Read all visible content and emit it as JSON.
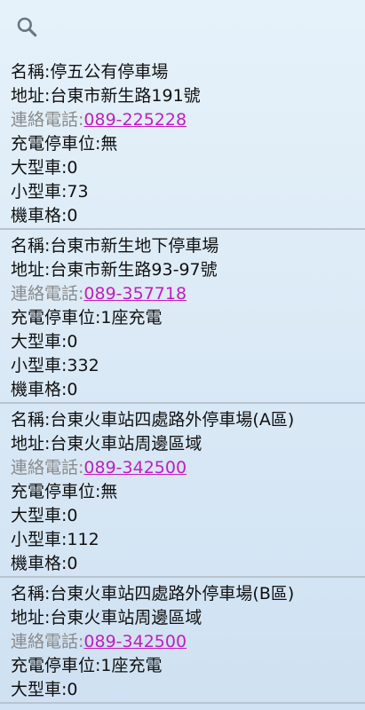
{
  "header": {
    "search_icon": "search-icon"
  },
  "labels": {
    "name": "名稱:",
    "address": "地址:",
    "phone": "連絡電話:",
    "charging": "充電停車位:",
    "large": "大型車:",
    "small": "小型車:",
    "motorcycle": "機車格:"
  },
  "colors": {
    "link": "#c21ec2",
    "phone_label": "#8a8a8a",
    "divider": "#b8c4cf"
  },
  "parking_lots": [
    {
      "name": "停五公有停車場",
      "address": "台東市新生路191號",
      "phone": "089-225228",
      "charging": "無",
      "large": "0",
      "small": "73",
      "motorcycle": "0"
    },
    {
      "name": "台東市新生地下停車場",
      "address": "台東市新生路93-97號",
      "phone": "089-357718",
      "charging": "1座充電",
      "large": "0",
      "small": "332",
      "motorcycle": "0"
    },
    {
      "name": "台東火車站四處路外停車場(A區)",
      "address": "台東火車站周邊區域",
      "phone": "089-342500",
      "charging": "無",
      "large": "0",
      "small": "112",
      "motorcycle": "0"
    },
    {
      "name": "台東火車站四處路外停車場(B區)",
      "address": "台東火車站周邊區域",
      "phone": "089-342500",
      "charging": "1座充電",
      "large": "0"
    }
  ]
}
